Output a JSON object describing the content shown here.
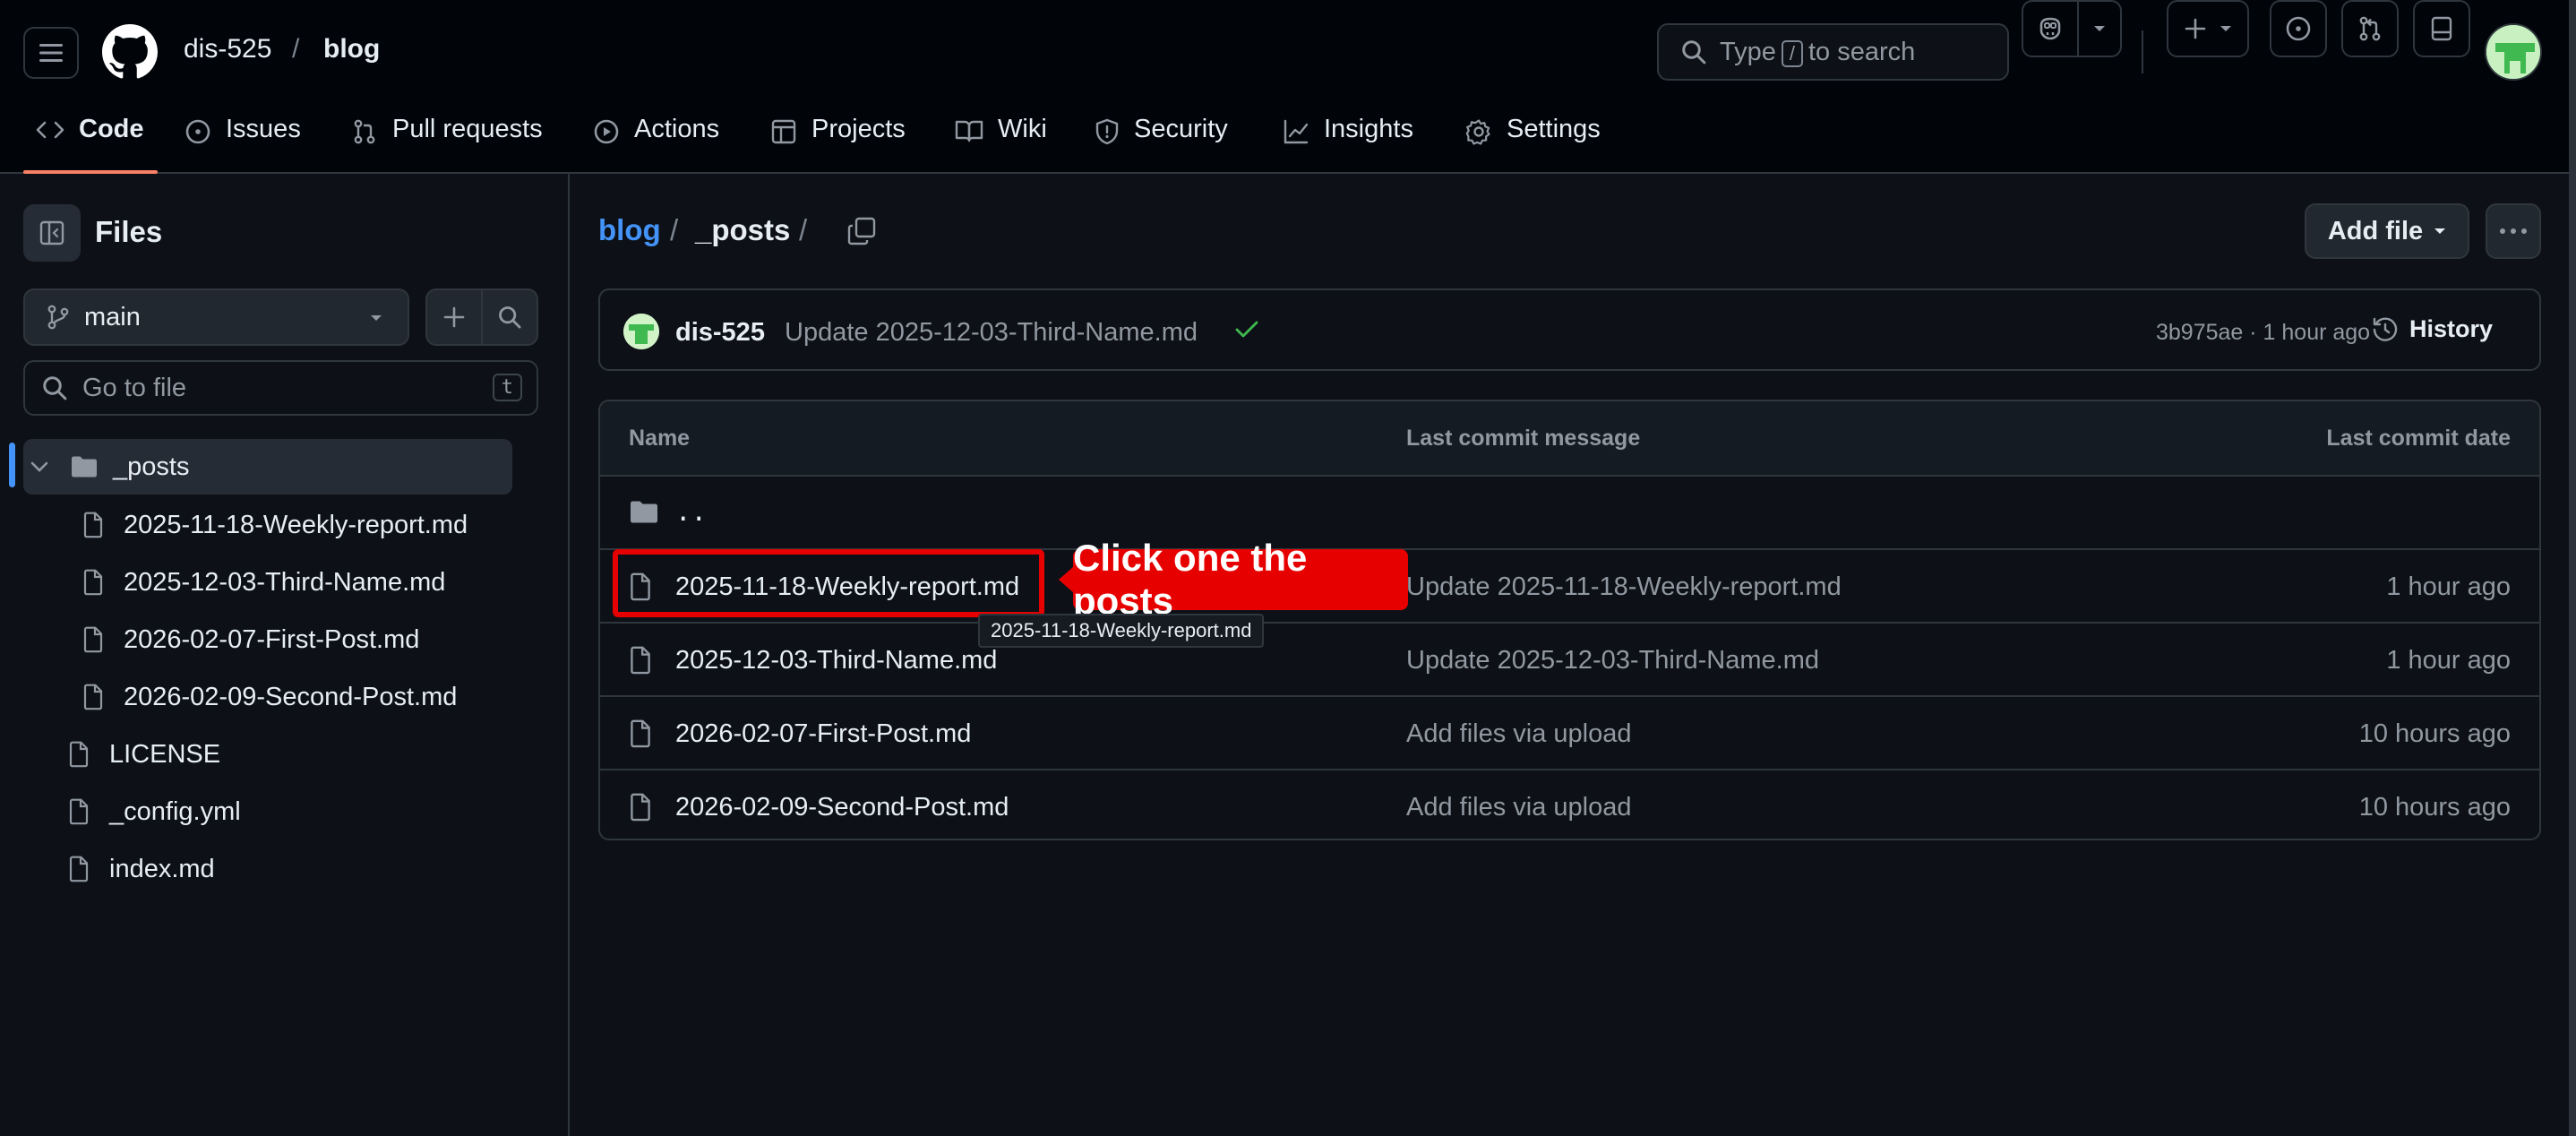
{
  "header": {
    "owner": "dis-525",
    "separator": "/",
    "repo": "blog",
    "search_prefix": "Type",
    "search_key": "/",
    "search_suffix": "to search"
  },
  "repo_nav": {
    "tabs": [
      {
        "label": "Code",
        "icon": "code-icon",
        "active": true
      },
      {
        "label": "Issues",
        "icon": "issue-icon"
      },
      {
        "label": "Pull requests",
        "icon": "pull-request-icon"
      },
      {
        "label": "Actions",
        "icon": "play-icon"
      },
      {
        "label": "Projects",
        "icon": "table-icon"
      },
      {
        "label": "Wiki",
        "icon": "book-icon"
      },
      {
        "label": "Security",
        "icon": "shield-icon"
      },
      {
        "label": "Insights",
        "icon": "graph-icon"
      },
      {
        "label": "Settings",
        "icon": "gear-icon"
      }
    ]
  },
  "sidebar": {
    "title": "Files",
    "branch": "main",
    "goto_placeholder": "Go to file",
    "goto_shortcut": "t",
    "tree": [
      {
        "label": "_posts",
        "type": "folder",
        "expanded": true,
        "selected": true
      },
      {
        "label": "2025-11-18-Weekly-report.md",
        "type": "file",
        "depth": 1
      },
      {
        "label": "2025-12-03-Third-Name.md",
        "type": "file",
        "depth": 1
      },
      {
        "label": "2026-02-07-First-Post.md",
        "type": "file",
        "depth": 1
      },
      {
        "label": "2026-02-09-Second-Post.md",
        "type": "file",
        "depth": 1
      },
      {
        "label": "LICENSE",
        "type": "file",
        "depth": 0
      },
      {
        "label": "_config.yml",
        "type": "file",
        "depth": 0
      },
      {
        "label": "index.md",
        "type": "file",
        "depth": 0
      }
    ]
  },
  "breadcrumb": {
    "repo": "blog",
    "sep": "/",
    "folder": "_posts",
    "trailing_sep": "/"
  },
  "actions": {
    "add_file": "Add file"
  },
  "latest_commit": {
    "author": "dis-525",
    "message": "Update 2025-12-03-Third-Name.md",
    "hash_time": "3b975ae · 1 hour ago",
    "history_label": "History",
    "status_color": "#3fb950"
  },
  "table": {
    "col_name": "Name",
    "col_message": "Last commit message",
    "col_date": "Last commit date",
    "parent_row": "..",
    "rows": [
      {
        "name": "2025-11-18-Weekly-report.md",
        "message": "Update 2025-11-18-Weekly-report.md",
        "date": "1 hour ago"
      },
      {
        "name": "2025-12-03-Third-Name.md",
        "message": "Update 2025-12-03-Third-Name.md",
        "date": "1 hour ago"
      },
      {
        "name": "2026-02-07-First-Post.md",
        "message": "Add files via upload",
        "date": "10 hours ago"
      },
      {
        "name": "2026-02-09-Second-Post.md",
        "message": "Add files via upload",
        "date": "10 hours ago"
      }
    ]
  },
  "annotation": {
    "label": "Click one the posts",
    "color": "#e60000",
    "tooltip": "2025-11-18-Weekly-report.md"
  },
  "colors": {
    "background": "#0d1117",
    "link": "#4493f8",
    "border": "#30363d",
    "active_tab_underline": "#f78166"
  }
}
